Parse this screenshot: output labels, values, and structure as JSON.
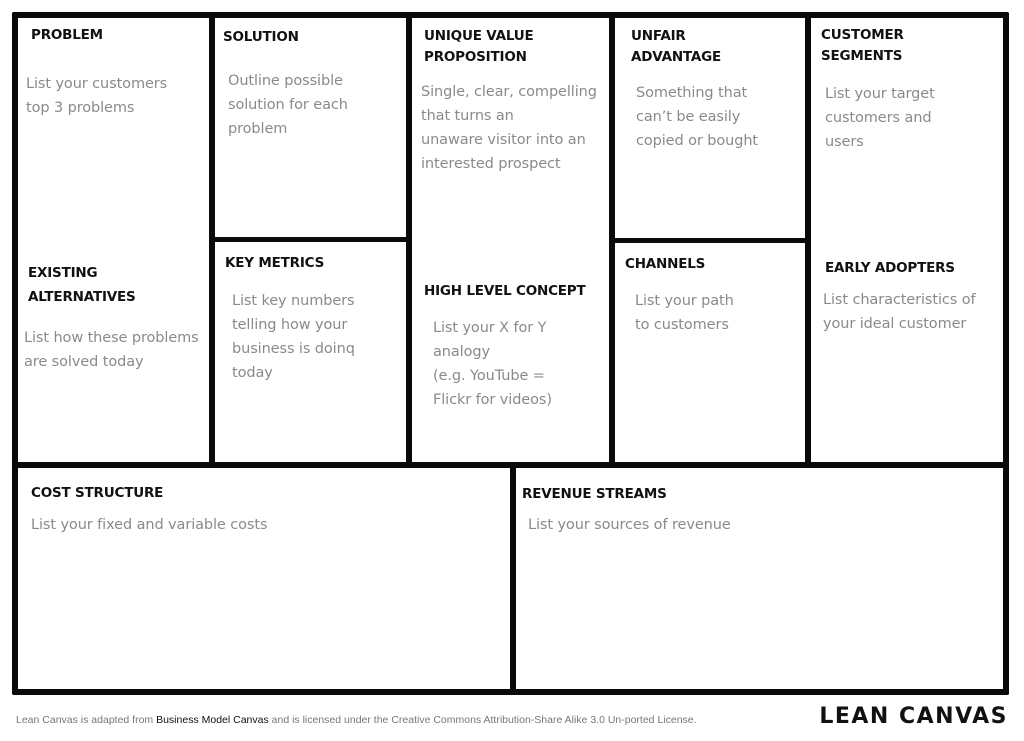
{
  "canvas": {
    "blocks": {
      "problem": {
        "title": "PROBLEM",
        "description": "List your customers\ntop 3 problems"
      },
      "existing_alternatives": {
        "title": "EXISTING\nALTERNATIVES",
        "description": "List how these problems\nare solved today"
      },
      "solution": {
        "title": "SOLUTION",
        "description": "Outline possible\nsolution for each\nproblem"
      },
      "key_metrics": {
        "title": "KEY  METRICS",
        "description": "List key numbers\ntelling how your\nbusiness is doinq\ntoday"
      },
      "unique_value_proposition": {
        "title": "UNIQUE VALUE\nPROPOSITION",
        "description": "Single, clear, compelling\nthat turns an\nunaware visitor into an\ninterested prospect"
      },
      "high_level_concept": {
        "title": "HIGH LEVEL CONCEPT",
        "description": "List your X for Y\nanalogy\n(e.g. YouTube =\nFlickr for videos)"
      },
      "unfair_advantage": {
        "title": "UNFAIR\nADVANTAGE",
        "description": "Something that\ncan’t be easily\ncopied or bought"
      },
      "channels": {
        "title": "CHANNELS",
        "description": "List your path\nto customers"
      },
      "customer_segments": {
        "title": "CUSTOMER\nSEGMENTS",
        "description": "List your target\ncustomers and\nusers"
      },
      "early_adopters": {
        "title": "EARLY ADOPTERS",
        "description": "List characteristics of\nyour ideal customer"
      },
      "cost_structure": {
        "title": "COST STRUCTURE",
        "description": "List your fixed and variable costs"
      },
      "revenue_streams": {
        "title": "REVENUE STREAMS",
        "description": "List your sources of revenue"
      }
    }
  },
  "footer": {
    "prefix": "Lean Canvas is adapted from ",
    "link": "Business Model Canvas",
    "suffix": " and is licensed under the Creative Commons Attribution-Share Alike 3.0 Un-ported License.",
    "brand": "LEAN CANVAS"
  }
}
